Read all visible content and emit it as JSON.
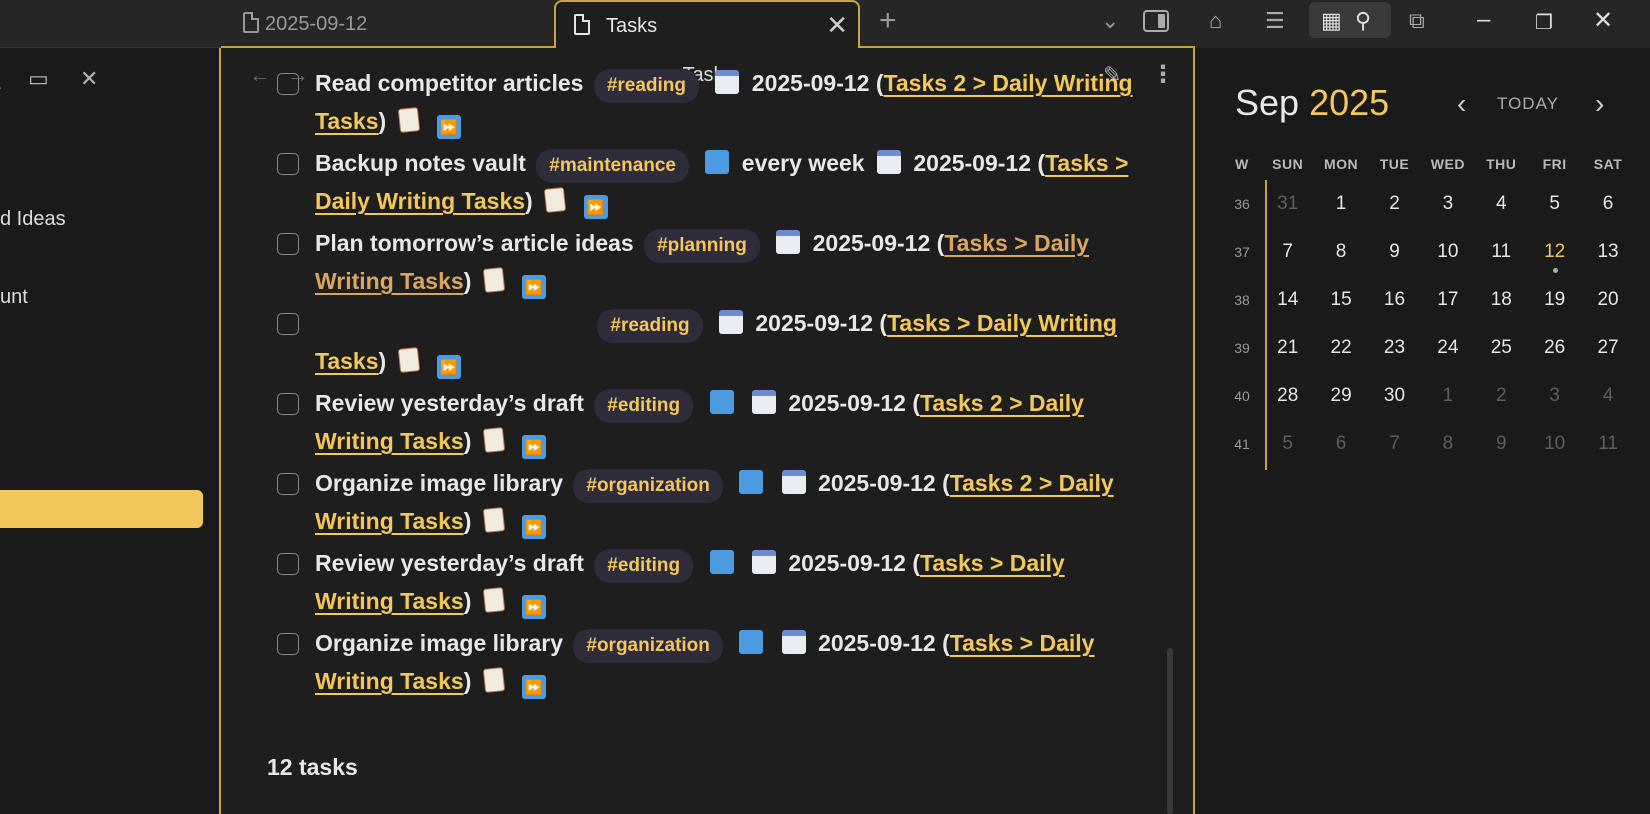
{
  "sidebar": {
    "items": [
      {
        "label": "d Ideas"
      },
      {
        "label": "unt"
      }
    ]
  },
  "tabs": [
    {
      "label": "2025-09-12",
      "active": false
    },
    {
      "label": "Tasks",
      "active": true
    }
  ],
  "view": {
    "title": "Tasks"
  },
  "tasks": [
    {
      "text": "Read competitor articles",
      "tag": "#reading",
      "date": "2025-09-12",
      "link": "Tasks 2 > Daily Writing Tasks"
    },
    {
      "text": "Backup notes vault",
      "tag": "#maintenance",
      "recurrence": "every week",
      "date": "2025-09-12",
      "link": "Tasks > Daily Writing Tasks"
    },
    {
      "text": "Plan tomorrow’s article ideas",
      "tag": "#planning",
      "date": "2025-09-12",
      "link": "Tasks > Daily Writing Tasks"
    },
    {
      "text": "",
      "tag": "#reading",
      "date": "2025-09-12",
      "link": "Tasks > Daily Writing Tasks"
    },
    {
      "text": "Review yesterday’s draft",
      "tag": "#editing",
      "date": "2025-09-12",
      "link": "Tasks 2 > Daily Writing Tasks"
    },
    {
      "text": "Organize image library",
      "tag": "#organization",
      "date": "2025-09-12",
      "link": "Tasks 2 > Daily Writing Tasks"
    },
    {
      "text": "Review yesterday’s draft",
      "tag": "#editing",
      "date": "2025-09-12",
      "link": "Tasks > Daily Writing Tasks"
    },
    {
      "text": "Organize image library",
      "tag": "#organization",
      "date": "2025-09-12",
      "link": "Tasks > Daily Writing Tasks"
    }
  ],
  "task_count": "12 tasks",
  "calendar": {
    "month": "Sep",
    "year": "2025",
    "today_label": "TODAY",
    "dow": [
      "W",
      "SUN",
      "MON",
      "TUE",
      "WED",
      "THU",
      "FRI",
      "SAT"
    ],
    "weeks": [
      {
        "w": "36",
        "days": [
          "31",
          "1",
          "2",
          "3",
          "4",
          "5",
          "6"
        ]
      },
      {
        "w": "37",
        "days": [
          "7",
          "8",
          "9",
          "10",
          "11",
          "12",
          "13"
        ]
      },
      {
        "w": "38",
        "days": [
          "14",
          "15",
          "16",
          "17",
          "18",
          "19",
          "20"
        ]
      },
      {
        "w": "39",
        "days": [
          "21",
          "22",
          "23",
          "24",
          "25",
          "26",
          "27"
        ]
      },
      {
        "w": "40",
        "days": [
          "28",
          "29",
          "30",
          "1",
          "2",
          "3",
          "4"
        ]
      },
      {
        "w": "41",
        "days": [
          "5",
          "6",
          "7",
          "8",
          "9",
          "10",
          "11"
        ]
      }
    ]
  },
  "colors": {
    "accent": "#f2c75c",
    "border": "#c9a43e",
    "tag_bg": "#2e2b3a"
  }
}
